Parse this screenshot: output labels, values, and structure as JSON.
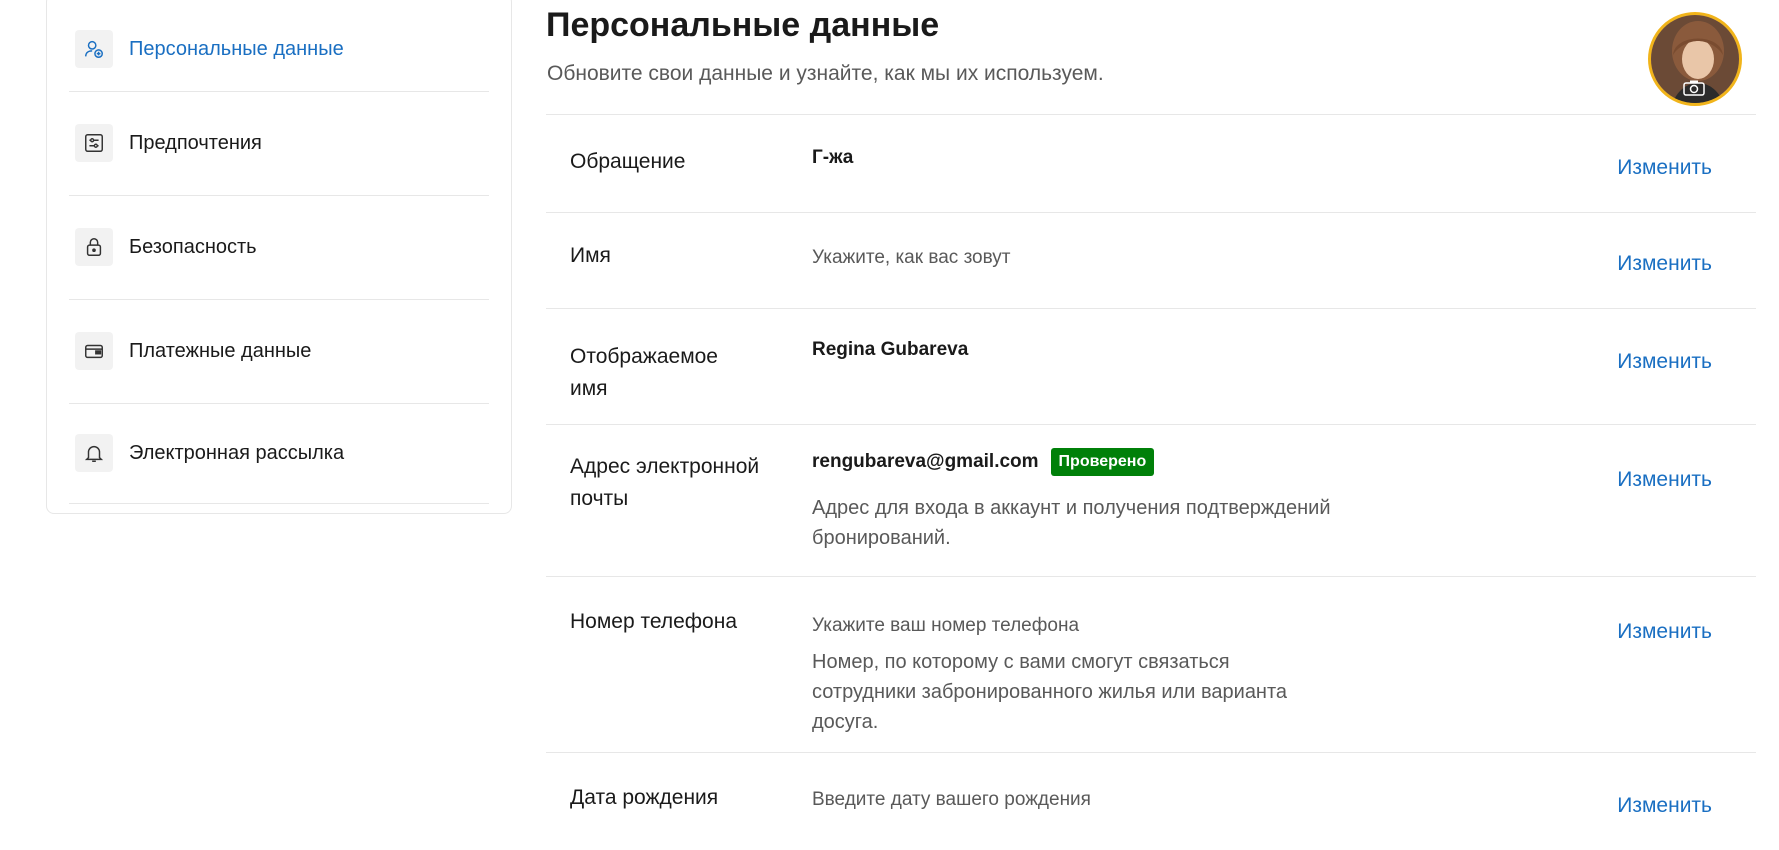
{
  "sidebar": {
    "items": [
      {
        "label": "Персональные данные",
        "icon": "user-edit-icon"
      },
      {
        "label": "Предпочтения",
        "icon": "sliders-icon"
      },
      {
        "label": "Безопасность",
        "icon": "lock-icon"
      },
      {
        "label": "Платежные данные",
        "icon": "wallet-icon"
      },
      {
        "label": "Электронная рассылка",
        "icon": "bell-icon"
      }
    ]
  },
  "main": {
    "title": "Персональные данные",
    "subtitle": "Обновите свои данные и узнайте, как мы их используем.",
    "edit_label": "Изменить",
    "rows": {
      "salutation": {
        "label": "Обращение",
        "value": "Г-жа"
      },
      "name": {
        "label": "Имя",
        "value": "Укажите, как вас зовут"
      },
      "display_name": {
        "label": "Отображаемое имя",
        "value": "Regina Gubareva"
      },
      "email": {
        "label": "Адрес электронной почты",
        "value": "rengubareva@gmail.com",
        "badge": "Проверено",
        "desc": "Адрес для входа в аккаунт и получения подтверждений бронирований."
      },
      "phone": {
        "label": "Номер телефона",
        "value": "Укажите ваш номер телефона",
        "desc": "Номер, по которому с вами смогут связаться сотрудники забронированного жилья или варианта досуга."
      },
      "birthdate": {
        "label": "Дата рождения",
        "value": "Введите дату вашего рождения"
      }
    }
  },
  "colors": {
    "accent": "#1a6fc2",
    "verified": "#008009",
    "avatar_ring": "#f1b41a"
  }
}
